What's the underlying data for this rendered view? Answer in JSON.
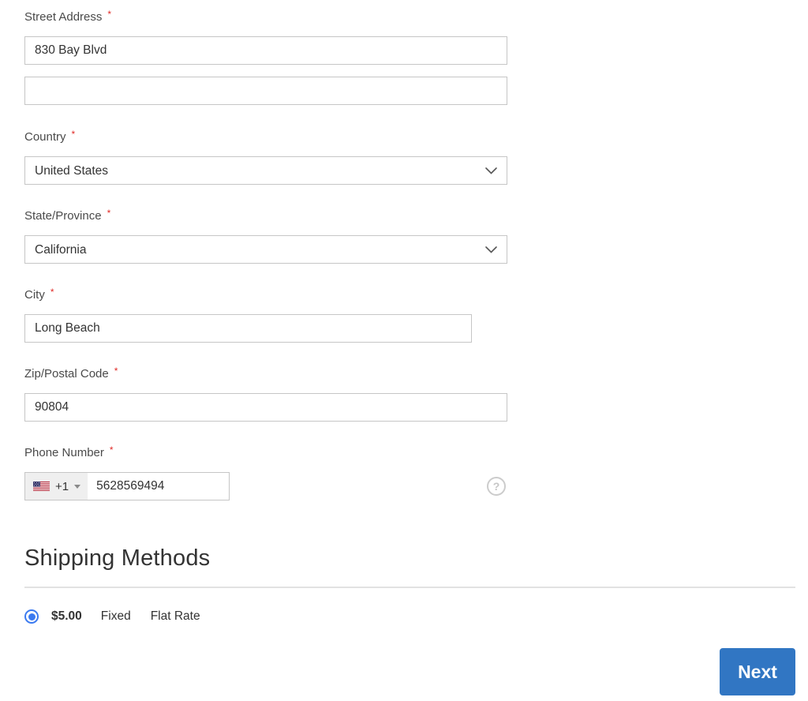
{
  "form": {
    "required_marker": "*",
    "street": {
      "label": "Street Address",
      "line1_value": "830 Bay Blvd",
      "line2_value": ""
    },
    "country": {
      "label": "Country",
      "value": "United States"
    },
    "state": {
      "label": "State/Province",
      "value": "California"
    },
    "city": {
      "label": "City",
      "value": "Long Beach"
    },
    "zip": {
      "label": "Zip/Postal Code",
      "value": "90804"
    },
    "phone": {
      "label": "Phone Number",
      "flag": "us-flag",
      "dial_code": "+1",
      "value": "5628569494",
      "help_glyph": "?"
    }
  },
  "shipping": {
    "title": "Shipping Methods",
    "options": [
      {
        "selected": true,
        "price": "$5.00",
        "method_title": "Fixed",
        "carrier_title": "Flat Rate"
      }
    ]
  },
  "actions": {
    "next_label": "Next"
  },
  "colors": {
    "accent_blue": "#3176c3",
    "radio_blue": "#3b7af0",
    "required_red": "#e02b27"
  }
}
